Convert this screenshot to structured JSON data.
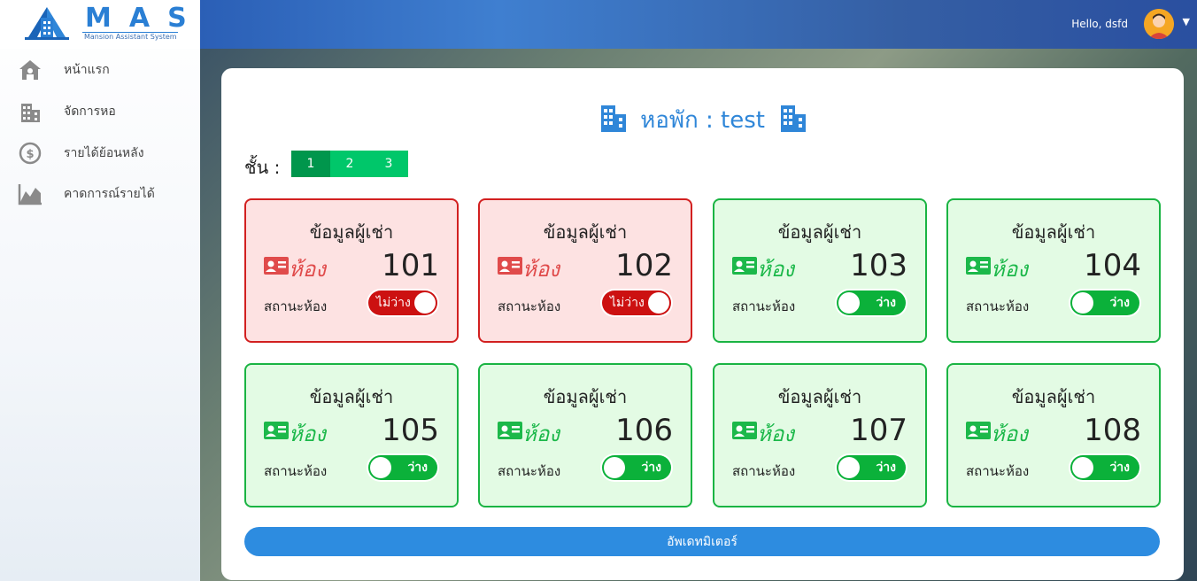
{
  "brand": {
    "title": "MAS",
    "subtitle": "Mansion Assistant System"
  },
  "sidebar": {
    "items": [
      {
        "label": "หน้าแรก",
        "icon": "home-icon"
      },
      {
        "label": "จัดการหอ",
        "icon": "building-icon"
      },
      {
        "label": "รายได้ย้อนหลัง",
        "icon": "dollar-icon"
      },
      {
        "label": "คาดการณ์รายได้",
        "icon": "chart-icon"
      }
    ]
  },
  "header": {
    "greeting": "Hello, dsfd"
  },
  "dorm": {
    "prefix": "หอพัก",
    "separator": ":",
    "name": "test"
  },
  "floors": {
    "label": "ชั้น :",
    "tabs": [
      "1",
      "2",
      "3"
    ],
    "active": "1"
  },
  "rooms": [
    {
      "heading": "ข้อมูลผู้เช่า",
      "word": "ห้อง",
      "number": "101",
      "status_label": "สถานะห้อง",
      "status": "ไม่ว่าง",
      "occupied": true
    },
    {
      "heading": "ข้อมูลผู้เช่า",
      "word": "ห้อง",
      "number": "102",
      "status_label": "สถานะห้อง",
      "status": "ไม่ว่าง",
      "occupied": true
    },
    {
      "heading": "ข้อมูลผู้เช่า",
      "word": "ห้อง",
      "number": "103",
      "status_label": "สถานะห้อง",
      "status": "ว่าง",
      "occupied": false
    },
    {
      "heading": "ข้อมูลผู้เช่า",
      "word": "ห้อง",
      "number": "104",
      "status_label": "สถานะห้อง",
      "status": "ว่าง",
      "occupied": false
    },
    {
      "heading": "ข้อมูลผู้เช่า",
      "word": "ห้อง",
      "number": "105",
      "status_label": "สถานะห้อง",
      "status": "ว่าง",
      "occupied": false
    },
    {
      "heading": "ข้อมูลผู้เช่า",
      "word": "ห้อง",
      "number": "106",
      "status_label": "สถานะห้อง",
      "status": "ว่าง",
      "occupied": false
    },
    {
      "heading": "ข้อมูลผู้เช่า",
      "word": "ห้อง",
      "number": "107",
      "status_label": "สถานะห้อง",
      "status": "ว่าง",
      "occupied": false
    },
    {
      "heading": "ข้อมูลผู้เช่า",
      "word": "ห้อง",
      "number": "108",
      "status_label": "สถานะห้อง",
      "status": "ว่าง",
      "occupied": false
    }
  ],
  "update_button": "อัพเดทมิเตอร์",
  "colors": {
    "accent": "#2d8ce0",
    "occupied": "#cc1111",
    "vacant": "#0bb13a",
    "tab": "#00c76a",
    "tab_active": "#00964c"
  }
}
